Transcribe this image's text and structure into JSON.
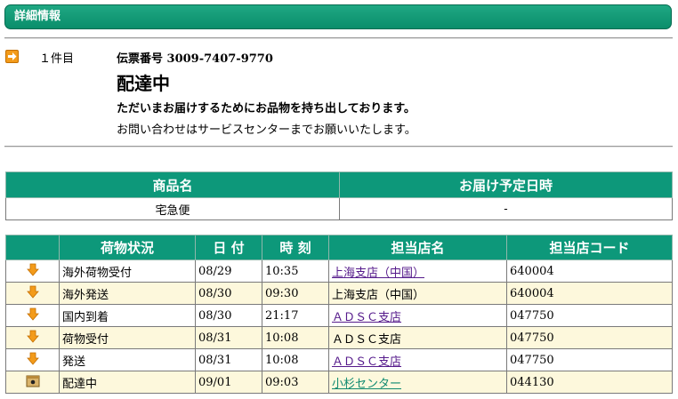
{
  "header": {
    "title": "詳細情報"
  },
  "summary": {
    "count_label": "１件目",
    "slip_label": "伝票番号",
    "slip_number": "3009-7407-9770",
    "status": "配達中",
    "message_main": "ただいまお届けするためにお品物を持ち出しております。",
    "message_contact": "お問い合わせはサービスセンターまでお願いいたします。"
  },
  "product_table": {
    "headers": [
      "商品名",
      "お届け予定日時"
    ],
    "row": {
      "product": "宅急便",
      "delivery": "-"
    }
  },
  "tracking_table": {
    "headers": [
      "荷物状況",
      "日 付",
      "時 刻",
      "担当店名",
      "担当店コード"
    ],
    "rows": [
      {
        "icon": "down-arrow-icon",
        "status": "海外荷物受付",
        "date": "08/29",
        "time": "10:35",
        "store": "上海支店（中国）",
        "store_link": true,
        "code": "640004"
      },
      {
        "icon": "down-arrow-icon",
        "status": "海外発送",
        "date": "08/30",
        "time": "09:30",
        "store": "上海支店（中国）",
        "store_link": false,
        "code": "640004"
      },
      {
        "icon": "down-arrow-icon",
        "status": "国内到着",
        "date": "08/30",
        "time": "21:17",
        "store": "ＡＤＳＣ支店",
        "store_link": true,
        "code": "047750"
      },
      {
        "icon": "down-arrow-icon",
        "status": "荷物受付",
        "date": "08/31",
        "time": "10:08",
        "store": "ＡＤＳＣ支店",
        "store_link": false,
        "code": "047750"
      },
      {
        "icon": "down-arrow-icon",
        "status": "発送",
        "date": "08/31",
        "time": "10:08",
        "store": "ＡＤＳＣ支店",
        "store_link": true,
        "code": "047750"
      },
      {
        "icon": "truck-package-icon",
        "status": "配達中",
        "date": "09/01",
        "time": "09:03",
        "store": "小杉センター",
        "store_link": true,
        "code": "044130"
      }
    ]
  },
  "colors": {
    "accent": "#0d987a",
    "row_alt": "#fdf8dc",
    "arrow": "#f39b1a"
  }
}
